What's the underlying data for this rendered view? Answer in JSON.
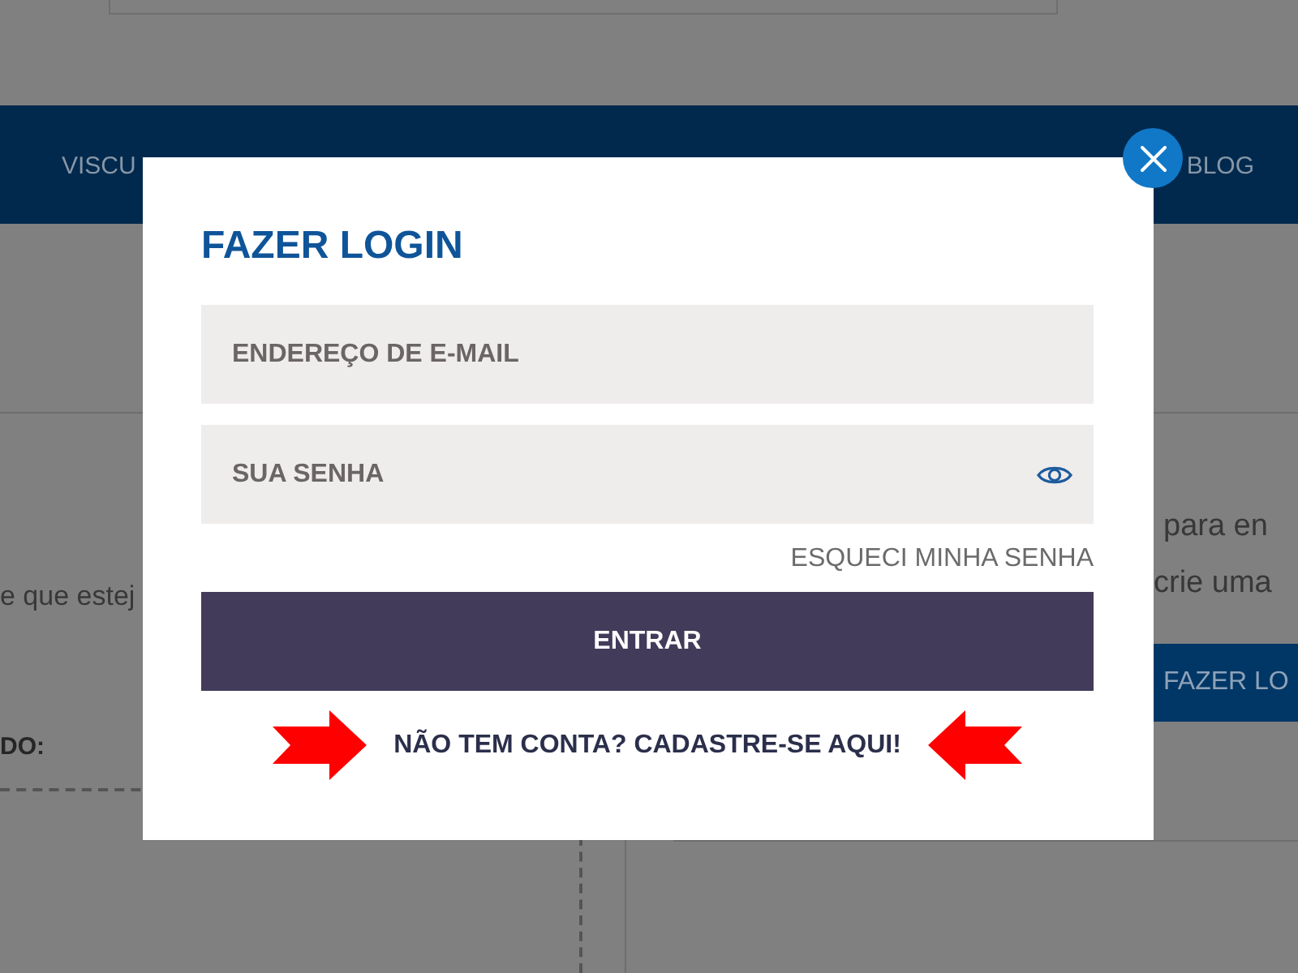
{
  "page": {
    "nav": {
      "items": [
        {
          "label": "VISCU"
        },
        {
          "label": "BLOG"
        }
      ]
    },
    "left_panel": {
      "text": "e que estej",
      "label": "DO:"
    },
    "right_panel": {
      "lines": [
        "para en",
        "crie uma"
      ],
      "button": "FAZER LO"
    }
  },
  "dialog": {
    "title": "FAZER LOGIN",
    "fields": [
      {
        "kind": "email",
        "placeholder": "ENDEREÇO DE E-MAIL"
      },
      {
        "kind": "password",
        "placeholder": "SUA SENHA"
      }
    ],
    "forgot_link": "ESQUECI MINHA SENHA",
    "submit": "ENTRAR",
    "register_link": "NÃO TEM CONTA? CADASTRE-SE AQUI!"
  }
}
